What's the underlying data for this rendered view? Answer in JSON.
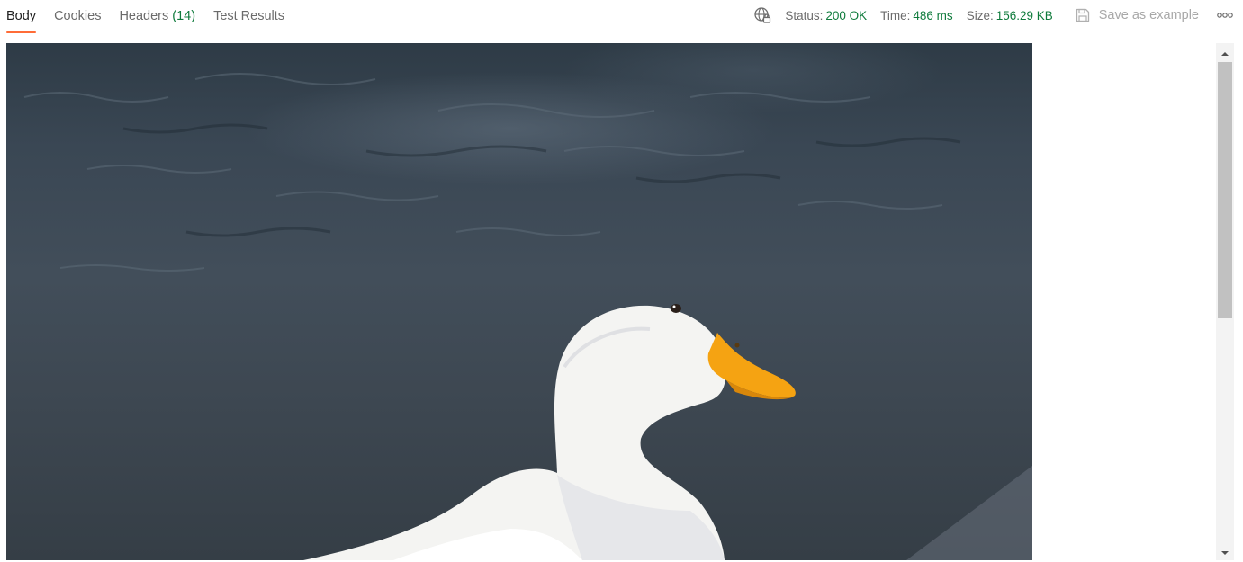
{
  "tabs": [
    {
      "label": "Body",
      "active": true
    },
    {
      "label": "Cookies",
      "active": false
    },
    {
      "label": "Headers",
      "count": "(14)",
      "active": false
    },
    {
      "label": "Test Results",
      "active": false
    }
  ],
  "response": {
    "status_label": "Status:",
    "status_value": "200 OK",
    "time_label": "Time:",
    "time_value": "486 ms",
    "size_label": "Size:",
    "size_value": "156.29 KB"
  },
  "actions": {
    "save_label": "Save as example",
    "more_icon": "ellipsis-icon",
    "network_icon": "globe-lock-icon"
  },
  "body_preview": {
    "type": "image",
    "subject_icon": "duck-photo"
  },
  "colors": {
    "accent": "#ff6c37",
    "success": "#0f7b3c",
    "muted": "#a8a8a8"
  }
}
